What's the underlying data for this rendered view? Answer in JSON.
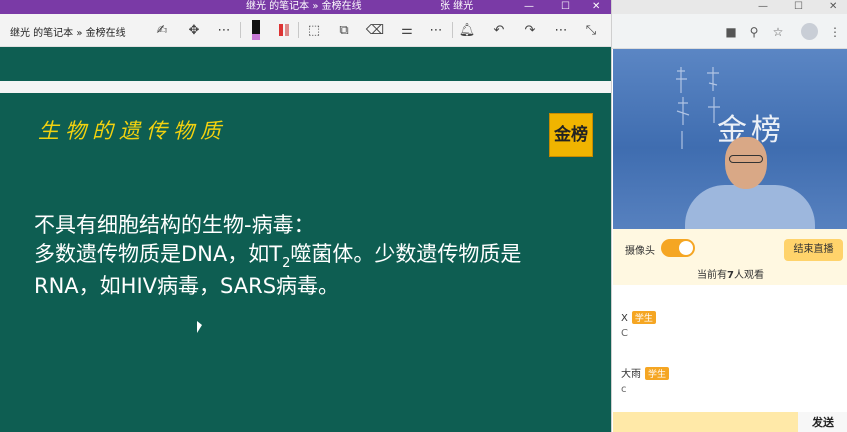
{
  "onenote": {
    "window_title": "继光 的笔记本 » 金榜在线",
    "user_name": "张 继光",
    "breadcrumb": "继光 的笔记本 » 金榜在线",
    "window_controls": {
      "minimize": "—",
      "maximize": "☐",
      "close": "✕"
    },
    "toolbar_icons": [
      "touch-writing-icon",
      "move-icon",
      "more-icon",
      "pen-black-icon",
      "pen-red-icon",
      "lasso-icon",
      "shapes-icon",
      "eraser-icon",
      "ruler-icon",
      "more-icon",
      "bell-icon",
      "undo-icon",
      "redo-icon",
      "more-icon",
      "fullscreen-icon"
    ],
    "board": {
      "heading": "生物的遗传物质",
      "logo_text": "金榜",
      "line1": "不具有细胞结构的生物-病毒：",
      "line2_a": "多数遗传物质是DNA，如T",
      "line2_sub": "2",
      "line2_b": "噬菌体。少数遗传物质是",
      "line3": "RNA，如HIV病毒，SARS病毒。"
    }
  },
  "browser": {
    "window_controls": {
      "minimize": "—",
      "maximize": "☐",
      "close": "✕"
    },
    "toolbar_icons": [
      "video-camera-icon",
      "zoom-icon",
      "star-icon",
      "account-icon",
      "menu-icon"
    ],
    "video": {
      "banner_text": "金榜"
    },
    "controls": {
      "camera_label": "摄像头",
      "camera_on": true,
      "end_live_button": "结束直播",
      "watchers_prefix": "当前有",
      "watchers_count": "7",
      "watchers_suffix": "人观看"
    },
    "chat": {
      "messages": [
        {
          "user": "X",
          "role": "学生",
          "text": "C"
        },
        {
          "user": "大雨",
          "role": "学生",
          "text": "c"
        }
      ]
    },
    "send_button": "发送"
  },
  "colors": {
    "board_green": "#0e5e52",
    "onenote_purple": "#7a3aa6",
    "heading_yellow": "#f2d20f",
    "accent_orange": "#f5a623"
  }
}
